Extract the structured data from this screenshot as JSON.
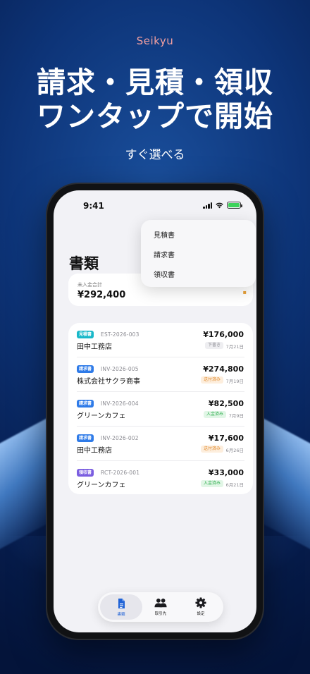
{
  "promo": {
    "brand": "Seikyu",
    "headline_line1": "請求・見積・領収",
    "headline_line2": "ワンタップで開始",
    "subline": "すぐ選べる"
  },
  "status_bar": {
    "time": "9:41"
  },
  "screen": {
    "title": "書類",
    "summary": {
      "label": "未入金合計",
      "value": "¥292,400"
    },
    "new_menu": {
      "items": [
        {
          "label": "見積書"
        },
        {
          "label": "請求書"
        },
        {
          "label": "領収書"
        }
      ]
    },
    "documents": [
      {
        "type": "見積書",
        "type_color": "#19b8c9",
        "number": "EST-2026-003",
        "client": "田中工務店",
        "amount": "¥176,000",
        "status": "下書き",
        "status_bg": "#eeeef1",
        "status_fg": "#8b8b92",
        "date": "7月21日"
      },
      {
        "type": "請求書",
        "type_color": "#2f7be8",
        "number": "INV-2026-005",
        "client": "株式会社サクラ商事",
        "amount": "¥274,800",
        "status": "送付済み",
        "status_bg": "#fdeedd",
        "status_fg": "#e0892a",
        "date": "7月19日"
      },
      {
        "type": "請求書",
        "type_color": "#2f7be8",
        "number": "INV-2026-004",
        "client": "グリーンカフェ",
        "amount": "¥82,500",
        "status": "入金済み",
        "status_bg": "#e1f6e6",
        "status_fg": "#2fae4e",
        "date": "7月9日"
      },
      {
        "type": "請求書",
        "type_color": "#2f7be8",
        "number": "INV-2026-002",
        "client": "田中工務店",
        "amount": "¥17,600",
        "status": "送付済み",
        "status_bg": "#fdeedd",
        "status_fg": "#e0892a",
        "date": "6月26日"
      },
      {
        "type": "領収書",
        "type_color": "#7b5ee0",
        "number": "RCT-2026-001",
        "client": "グリーンカフェ",
        "amount": "¥33,000",
        "status": "入金済み",
        "status_bg": "#e1f6e6",
        "status_fg": "#2fae4e",
        "date": "6月21日"
      }
    ]
  },
  "tab_bar": {
    "tabs": [
      {
        "label": "書類",
        "icon": "document-icon",
        "active": true
      },
      {
        "label": "取引先",
        "icon": "people-icon",
        "active": false
      },
      {
        "label": "設定",
        "icon": "gear-icon",
        "active": false
      }
    ]
  }
}
